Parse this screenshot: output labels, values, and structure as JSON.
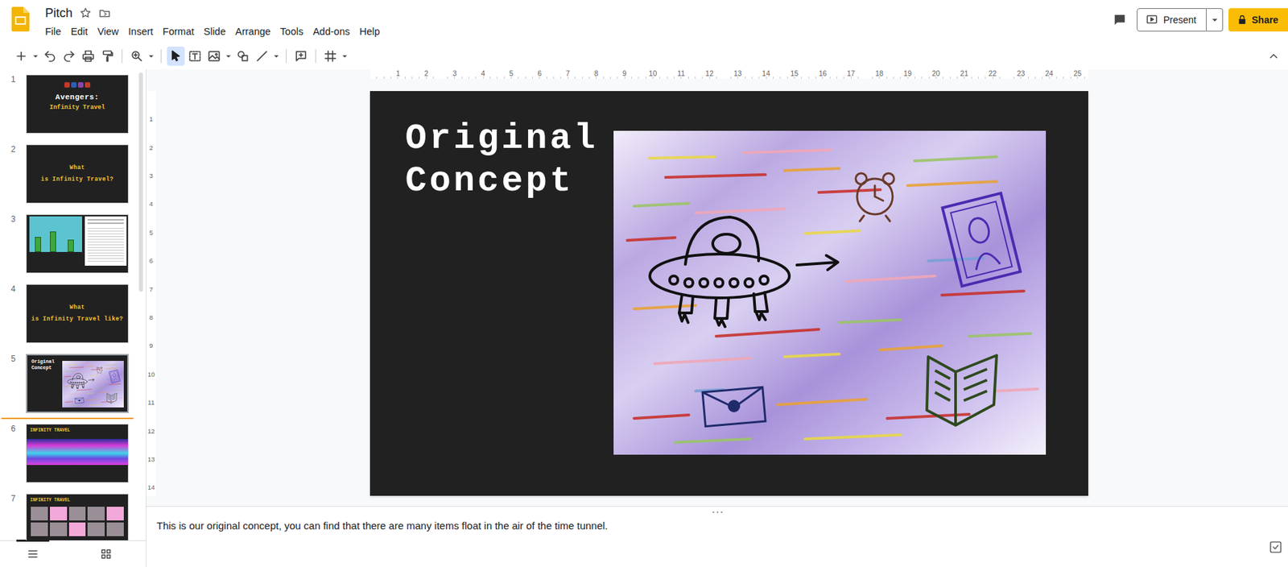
{
  "document": {
    "title": "Pitch"
  },
  "menu": [
    "File",
    "Edit",
    "View",
    "Insert",
    "Format",
    "Slide",
    "Arrange",
    "Tools",
    "Add-ons",
    "Help"
  ],
  "header": {
    "present": "Present",
    "share": "Share"
  },
  "toolbar": {
    "select_tool_selected": true
  },
  "rulers": {
    "horizontal": [
      "1",
      "2",
      "3",
      "4",
      "5",
      "6",
      "7",
      "8",
      "9",
      "10",
      "11",
      "12",
      "13",
      "14",
      "15",
      "16",
      "17",
      "18",
      "19",
      "20",
      "21",
      "22",
      "23",
      "24",
      "25"
    ],
    "vertical": [
      "1",
      "2",
      "3",
      "4",
      "5",
      "6",
      "7",
      "8",
      "9",
      "10",
      "11",
      "12",
      "13",
      "14"
    ]
  },
  "filmstrip": {
    "slides": [
      {
        "number": "1",
        "kind": "cover",
        "lines": [
          "Avengers:",
          "Infinity Travel"
        ],
        "selected": false
      },
      {
        "number": "2",
        "kind": "title",
        "lines": [
          "What",
          "is Infinity Travel?"
        ],
        "selected": false
      },
      {
        "number": "3",
        "kind": "images",
        "lines": [],
        "selected": false
      },
      {
        "number": "4",
        "kind": "title",
        "lines": [
          "What",
          "is Infinity Travel like?"
        ],
        "selected": false
      },
      {
        "number": "5",
        "kind": "concept",
        "lines": [
          "Original",
          "Concept"
        ],
        "selected": true
      },
      {
        "number": "6",
        "kind": "banner",
        "lines": [
          "INFINITY TRAVEL"
        ],
        "selected": false
      },
      {
        "number": "7",
        "kind": "gallery",
        "lines": [
          "INFINITY TRAVEL"
        ],
        "selected": false
      }
    ],
    "view_modes": [
      {
        "selected": true
      },
      {
        "selected": false
      }
    ]
  },
  "slide": {
    "title": [
      "Original",
      "Concept"
    ]
  },
  "speaker_notes": "This is our original concept, you can find that there are many items float in the air of the time tunnel."
}
